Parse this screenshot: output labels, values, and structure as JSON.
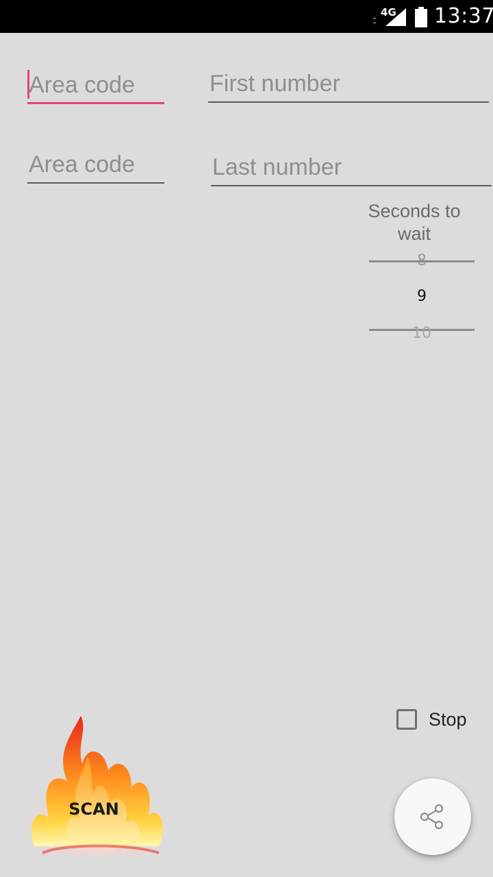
{
  "status_bar": {
    "network": "4G",
    "time": "13:37"
  },
  "form": {
    "start_area_code": {
      "value": "",
      "placeholder": "Area code"
    },
    "first_number": {
      "value": "",
      "placeholder": "First number"
    },
    "end_area_code": {
      "value": "",
      "placeholder": "Area code"
    },
    "last_number": {
      "value": "",
      "placeholder": "Last number"
    }
  },
  "wait_picker": {
    "title": "Seconds to wait",
    "previous": "8",
    "current": "9",
    "next": "10"
  },
  "stop_checkbox": {
    "label": "Stop",
    "checked": false
  },
  "scan_button": {
    "label": "SCAN"
  },
  "share_button": {
    "icon": "share-icon"
  },
  "colors": {
    "background": "#dcdcdc",
    "accent": "#e8407a",
    "status_bar": "#000000"
  }
}
